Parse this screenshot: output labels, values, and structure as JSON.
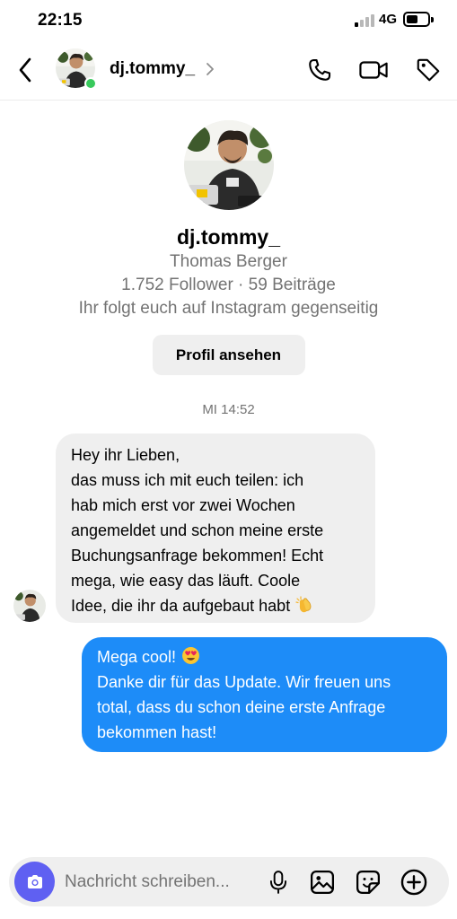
{
  "status_bar": {
    "time": "22:15",
    "network": "4G"
  },
  "header": {
    "username": "dj.tommy_",
    "online": true
  },
  "profile": {
    "username": "dj.tommy_",
    "full_name": "Thomas Berger",
    "stats": "1.752 Follower · 59 Beiträge",
    "mutual": "Ihr folgt euch auf Instagram gegenseitig",
    "button_label": "Profil ansehen"
  },
  "conversation": {
    "timestamp": "MI 14:52",
    "incoming": {
      "lines": [
        "Hey ihr Lieben,",
        "das muss ich mit euch teilen: ich",
        "hab mich erst vor zwei Wochen",
        "angemeldet und schon meine erste",
        "Buchungsanfrage bekommen! Echt",
        "mega, wie easy das läuft. Coole",
        "Idee, die ihr da aufgebaut habt"
      ],
      "emoji": "clapping-hands"
    },
    "outgoing": {
      "first_line": "Mega cool!",
      "emoji": "heart-eyes",
      "lines": [
        "Danke dir für das Update. Wir freuen uns",
        "total, dass du schon deine erste Anfrage",
        "bekommen hast!"
      ]
    }
  },
  "composer": {
    "placeholder": "Nachricht schreiben..."
  },
  "colors": {
    "outgoing_bubble": "#1d8cf8",
    "incoming_bubble": "#efefef",
    "camera_button": "#5f60f2",
    "online": "#38c95c"
  }
}
